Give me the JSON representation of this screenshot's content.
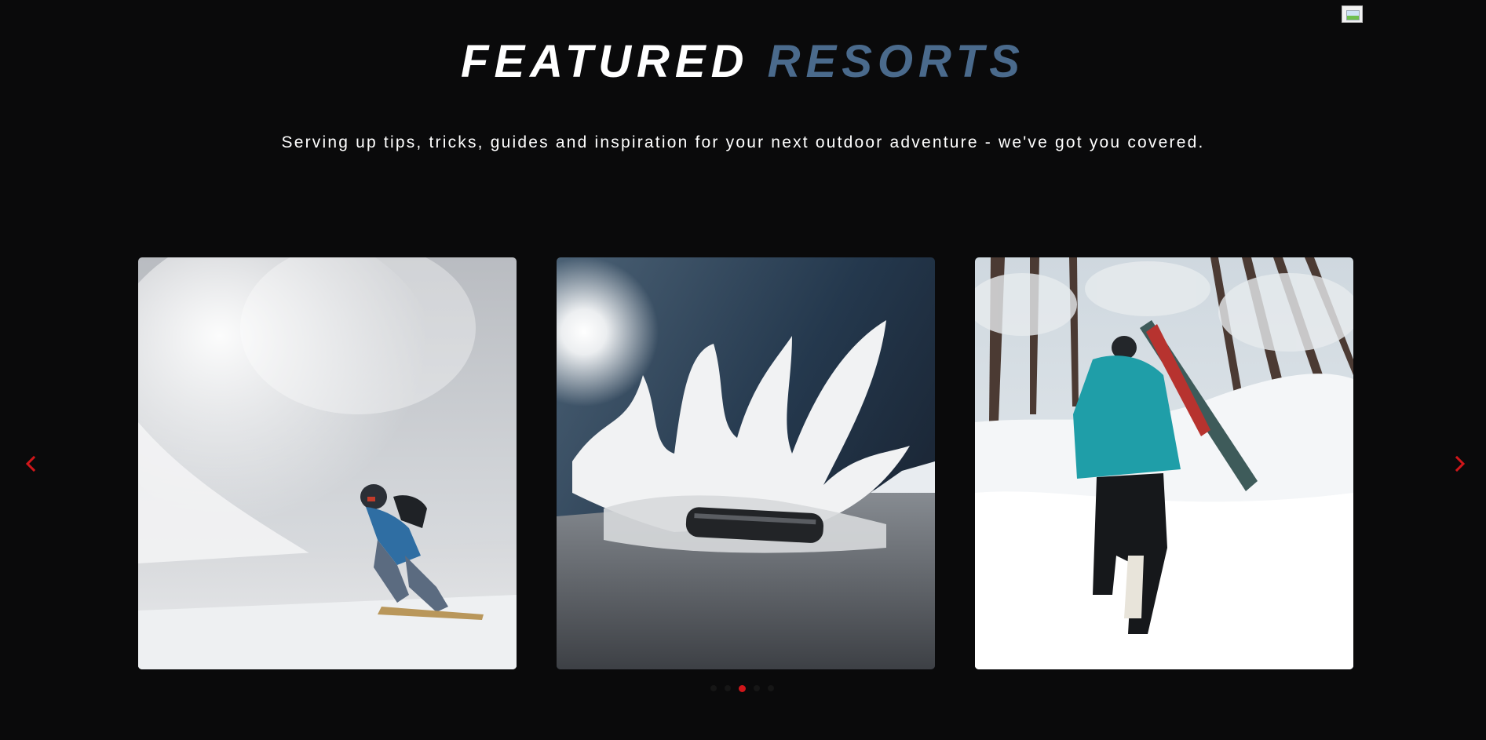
{
  "header": {
    "title_word1": "FEATURED",
    "title_word2": "RESORTS",
    "subtitle": "Serving up tips, tricks, guides and inspiration for your next outdoor adventure - we've got you covered."
  },
  "carousel": {
    "slides": [
      {
        "icon": "snowboarder-powder-image"
      },
      {
        "icon": "snowboard-snow-burst-image"
      },
      {
        "icon": "skier-hiking-forest-image"
      }
    ],
    "dots_count": 5,
    "active_dot": 3,
    "prev_icon": "chevron-left-icon",
    "next_icon": "chevron-right-icon"
  },
  "colors": {
    "background": "#0a0a0b",
    "accent_red": "#d0161a",
    "title_blue": "#4a6a8c",
    "title_white": "#ffffff"
  }
}
